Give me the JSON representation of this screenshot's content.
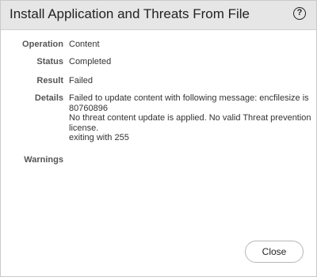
{
  "dialog": {
    "title": "Install Application and Threats From File",
    "help_icon_glyph": "?",
    "help_icon": "question-circle-icon"
  },
  "fields": {
    "operation": {
      "label": "Operation",
      "value": "Content"
    },
    "status": {
      "label": "Status",
      "value": "Completed"
    },
    "result": {
      "label": "Result",
      "value": "Failed"
    },
    "details": {
      "label": "Details",
      "lines": [
        "Failed to update content with following message: encfilesize is",
        "80760896",
        "No threat content update is applied. No valid Threat prevention",
        "license.",
        "exiting with 255"
      ]
    },
    "warnings": {
      "label": "Warnings",
      "value": ""
    }
  },
  "footer": {
    "close_label": "Close"
  },
  "colors": {
    "titlebar_bg": "#e6e6e6",
    "label_text": "#555555",
    "value_text": "#333333",
    "border": "#c9c9c9"
  }
}
